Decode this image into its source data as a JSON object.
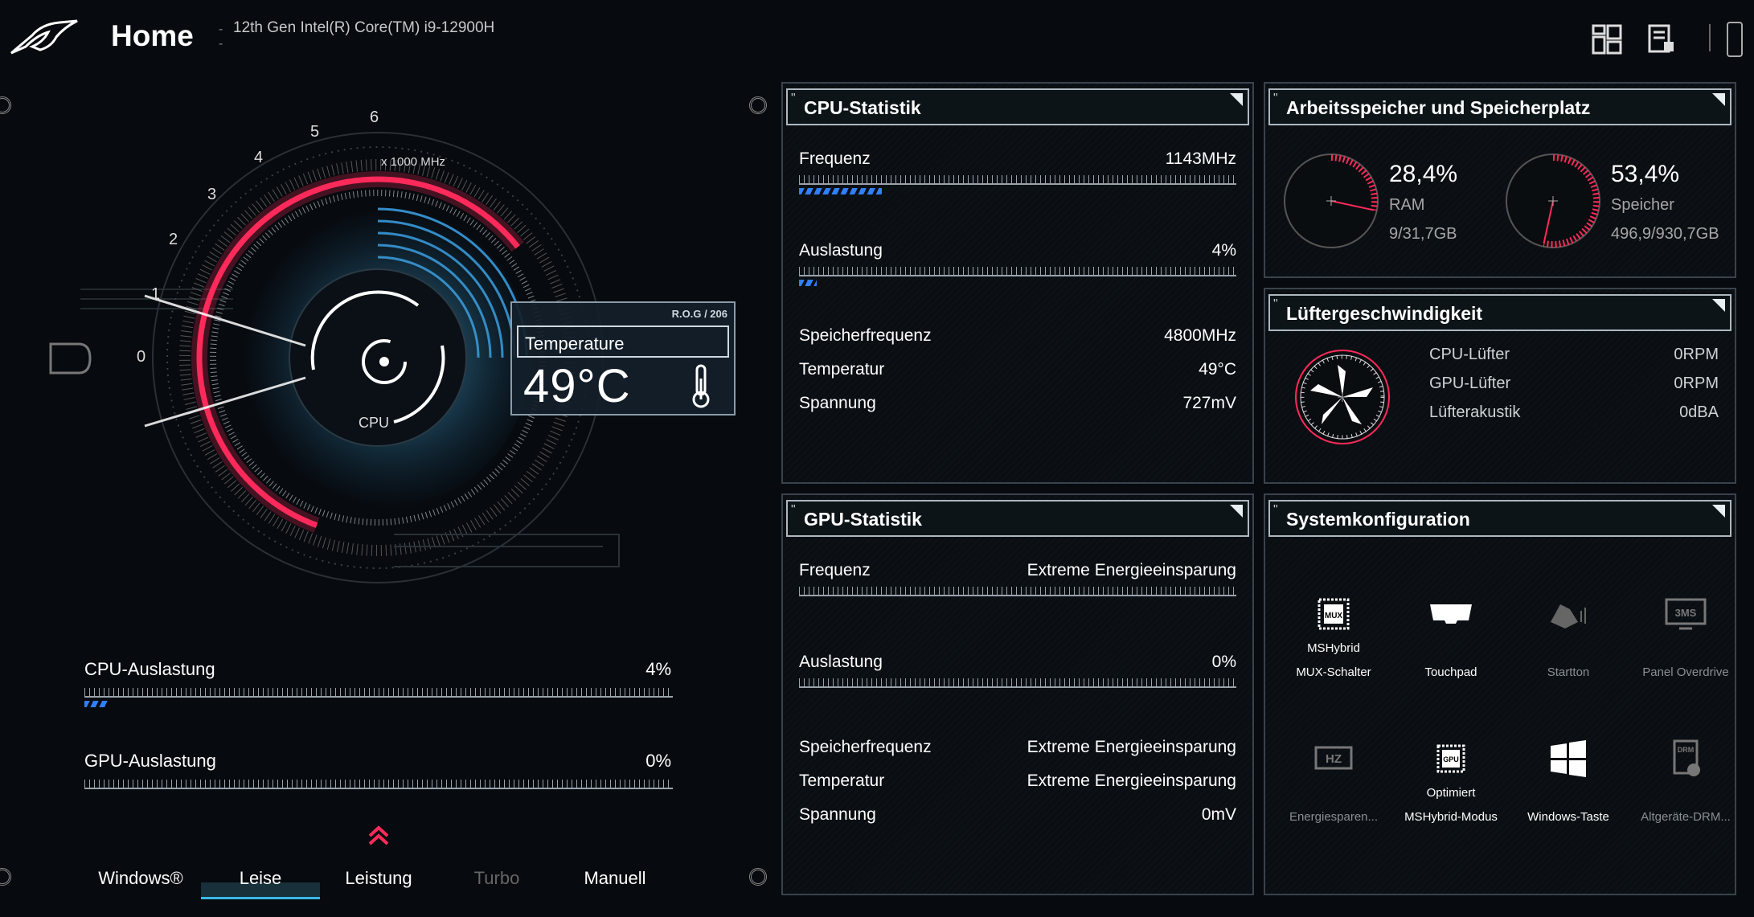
{
  "header": {
    "title": "Home",
    "cpu_model": "12th Gen Intel(R) Core(TM) i9-12900H"
  },
  "gauge": {
    "scale_labels": [
      "0",
      "1",
      "2",
      "3",
      "4",
      "5",
      "6"
    ],
    "unit": "x 1000 MHz",
    "center_label": "CPU",
    "temp_card": {
      "brand": "R.O.G / 206",
      "label": "Temperature",
      "value": "49°C"
    }
  },
  "left_bars": [
    {
      "label": "CPU-Auslastung",
      "value": "4%",
      "fill": 0.04
    },
    {
      "label": "GPU-Auslastung",
      "value": "0%",
      "fill": 0.0
    }
  ],
  "modes": {
    "items": [
      "Windows®",
      "Leise",
      "Leistung",
      "Turbo",
      "Manuell"
    ],
    "selected": "Leise",
    "disabled": [
      "Turbo"
    ]
  },
  "cpu_panel": {
    "title": "CPU-Statistik",
    "frequency": {
      "label": "Frequenz",
      "value": "1143MHz",
      "fill": 0.19
    },
    "usage": {
      "label": "Auslastung",
      "value": "4%",
      "fill": 0.04
    },
    "rows": [
      {
        "label": "Speicherfrequenz",
        "value": "4800MHz"
      },
      {
        "label": "Temperatur",
        "value": "49°C"
      },
      {
        "label": "Spannung",
        "value": "727mV"
      }
    ]
  },
  "gpu_panel": {
    "title": "GPU-Statistik",
    "frequency": {
      "label": "Frequenz",
      "value": "Extreme Energieeinsparung"
    },
    "usage": {
      "label": "Auslastung",
      "value": "0%"
    },
    "rows": [
      {
        "label": "Speicherfrequenz",
        "value": "Extreme Energieeinsparung"
      },
      {
        "label": "Temperatur",
        "value": "Extreme Energieeinsparung"
      },
      {
        "label": "Spannung",
        "value": "0mV"
      }
    ]
  },
  "memory_panel": {
    "title": "Arbeitsspeicher und Speicherplatz",
    "ram": {
      "percent": "28,4%",
      "label": "RAM",
      "detail": "9/31,7GB",
      "fraction": 0.284
    },
    "storage": {
      "percent": "53,4%",
      "label": "Speicher",
      "detail": "496,9/930,7GB",
      "fraction": 0.534
    }
  },
  "fan_panel": {
    "title": "Lüftergeschwindigkeit",
    "rows": [
      {
        "label": "CPU-Lüfter",
        "value": "0RPM"
      },
      {
        "label": "GPU-Lüfter",
        "value": "0RPM"
      },
      {
        "label": "Lüfterakustik",
        "value": "0dBA"
      }
    ]
  },
  "sysconfig_panel": {
    "title": "Systemkonfiguration",
    "items": [
      {
        "line1": "MSHybrid",
        "line2": "MUX-Schalter",
        "icon": "mux-icon",
        "dim": false
      },
      {
        "line1": "",
        "line2": "Touchpad",
        "icon": "touchpad-icon",
        "dim": false
      },
      {
        "line1": "",
        "line2": "Startton",
        "icon": "boot-sound-icon",
        "dim": true
      },
      {
        "line1": "",
        "line2": "Panel Overdrive",
        "icon": "panel-overdrive-icon",
        "dim": true
      },
      {
        "line1": "",
        "line2": "Energiesparen...",
        "icon": "hz-icon",
        "dim": true
      },
      {
        "line1": "Optimiert",
        "line2": "MSHybrid-Modus",
        "icon": "gpu-mode-icon",
        "dim": false
      },
      {
        "line1": "",
        "line2": "Windows-Taste",
        "icon": "windows-key-icon",
        "dim": false
      },
      {
        "line1": "",
        "line2": "Altgeräte-DRM...",
        "icon": "drm-icon",
        "dim": true
      }
    ]
  },
  "colors": {
    "accent_red": "#ff2a5a",
    "accent_blue": "#3ab8e8",
    "bar_blue": "#2f7fff"
  }
}
